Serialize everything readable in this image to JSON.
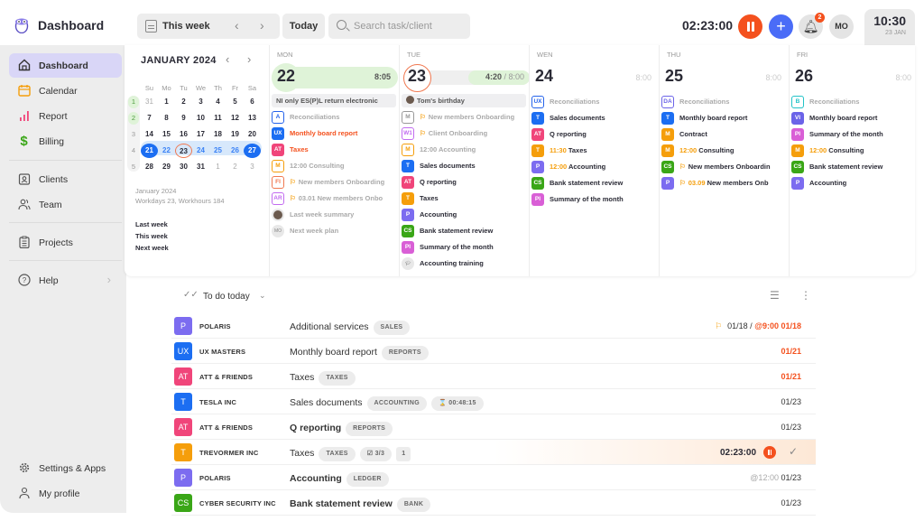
{
  "header": {
    "app_title": "Dashboard",
    "week_selector": "This week",
    "today_label": "Today",
    "search_placeholder": "Search task/client",
    "timer": "02:23:00",
    "notification_count": "2",
    "avatar_initials": "MO",
    "clock_time": "10:30",
    "clock_date": "23 JAN"
  },
  "sidebar": {
    "items": [
      {
        "label": "Dashboard",
        "icon": "home-icon",
        "active": true
      },
      {
        "label": "Calendar",
        "icon": "calendar-icon"
      },
      {
        "label": "Report",
        "icon": "bar-chart-icon"
      },
      {
        "label": "Billing",
        "icon": "dollar-icon"
      },
      {
        "label": "Clients",
        "icon": "contact-card-icon"
      },
      {
        "label": "Team",
        "icon": "team-icon"
      },
      {
        "label": "Projects",
        "icon": "clipboard-icon"
      },
      {
        "label": "Help",
        "icon": "help-icon"
      }
    ],
    "bottom": [
      {
        "label": "Settings & Apps",
        "icon": "gear-icon"
      },
      {
        "label": "My profile",
        "icon": "user-icon"
      }
    ]
  },
  "mini_calendar": {
    "month": "JANUARY 2024",
    "weekdays": [
      "Su",
      "Mo",
      "Tu",
      "We",
      "Th",
      "Fr",
      "Sa"
    ],
    "weeks": [
      {
        "num": "1",
        "days": [
          "31",
          "1",
          "2",
          "3",
          "4",
          "5",
          "6"
        ]
      },
      {
        "num": "2",
        "days": [
          "7",
          "8",
          "9",
          "10",
          "11",
          "12",
          "13"
        ]
      },
      {
        "num": "3",
        "days": [
          "14",
          "15",
          "16",
          "17",
          "18",
          "19",
          "20"
        ]
      },
      {
        "num": "4",
        "days": [
          "21",
          "22",
          "23",
          "24",
          "25",
          "26",
          "27"
        ]
      },
      {
        "num": "5",
        "days": [
          "28",
          "29",
          "30",
          "31",
          "1",
          "2",
          "3"
        ]
      }
    ],
    "info_month": "January 2024",
    "info_stats": "Workdays 23, Workhours 184",
    "quick_links": [
      "Last week",
      "This week",
      "Next week"
    ]
  },
  "days": [
    {
      "name": "MON",
      "num": "22",
      "hours": "8:05",
      "banner": "NI only ES(P)L return electronic",
      "events": [
        {
          "badge": "A",
          "color": "#2563eb",
          "outline": true,
          "text": "Reconciliations",
          "style": "g"
        },
        {
          "badge": "UX",
          "color": "#1c6ef2",
          "text": "Monthly board report",
          "style": "red"
        },
        {
          "badge": "AT",
          "color": "#f0457a",
          "text": "Taxes",
          "style": "red"
        },
        {
          "badge": "M",
          "color": "#f59e0b",
          "outline": true,
          "text": "12:00 Consulting",
          "style": "g"
        },
        {
          "badge": "FI",
          "color": "#f07850",
          "outline": true,
          "flag": true,
          "text": "New members Onboarding",
          "style": "g"
        },
        {
          "badge": "AR",
          "color": "#c26bf0",
          "outline": true,
          "flag": true,
          "text": "03.01 New members Onbo",
          "style": "g"
        },
        {
          "round": "photo",
          "text": "Last week summary",
          "style": "g"
        },
        {
          "round": "MO",
          "text": "Next week plan",
          "style": "g"
        }
      ]
    },
    {
      "name": "TUE",
      "num": "23",
      "hours_done": "4:20",
      "hours_total": "/ 8:00",
      "banner": "Tom's birthday",
      "events": [
        {
          "badge": "M",
          "color": "#999999",
          "outline": true,
          "flag": true,
          "text": "New members Onboarding",
          "style": "g"
        },
        {
          "badge": "W1",
          "color": "#c26bf0",
          "outline": true,
          "flag": true,
          "text": "Client Onboarding",
          "style": "g"
        },
        {
          "badge": "M",
          "color": "#f59e0b",
          "outline": true,
          "text": "12:00 Accounting",
          "style": "g"
        },
        {
          "badge": "T",
          "color": "#1c6ef2",
          "text": "Sales documents"
        },
        {
          "badge": "AT",
          "color": "#f0457a",
          "text": "Q reporting"
        },
        {
          "badge": "T",
          "color": "#f59e0b",
          "text": "Taxes"
        },
        {
          "badge": "P",
          "color": "#7c6cf0",
          "text": "Accounting"
        },
        {
          "badge": "CS",
          "color": "#3aa617",
          "text": "Bank statement review"
        },
        {
          "badge": "PI",
          "color": "#d95fd6",
          "text": "Summary of the month"
        },
        {
          "round": "cap",
          "text": "Accounting training"
        }
      ]
    },
    {
      "name": "WEN",
      "num": "24",
      "hours": "8:00",
      "events": [
        {
          "badge": "UX",
          "color": "#2563eb",
          "outline": true,
          "text": "Reconciliations",
          "style": "g"
        },
        {
          "badge": "T",
          "color": "#1c6ef2",
          "text": "Sales documents"
        },
        {
          "badge": "AT",
          "color": "#f0457a",
          "text": "Q reporting"
        },
        {
          "badge": "T",
          "color": "#f59e0b",
          "time": "11:30",
          "text": "Taxes"
        },
        {
          "badge": "P",
          "color": "#7c6cf0",
          "time": "12:00",
          "text": "Accounting"
        },
        {
          "badge": "CS",
          "color": "#3aa617",
          "text": "Bank statement review"
        },
        {
          "badge": "PI",
          "color": "#d95fd6",
          "text": "Summary of the month"
        }
      ]
    },
    {
      "name": "THU",
      "num": "25",
      "hours": "8:00",
      "events": [
        {
          "badge": "DA",
          "color": "#6b63e8",
          "outline": true,
          "text": "Reconciliations",
          "style": "g"
        },
        {
          "badge": "T",
          "color": "#1c6ef2",
          "text": "Monthly board report"
        },
        {
          "badge": "M",
          "color": "#f59e0b",
          "text": "Contract"
        },
        {
          "badge": "M",
          "color": "#f59e0b",
          "time": "12:00",
          "text": "Consulting"
        },
        {
          "badge": "CS",
          "color": "#3aa617",
          "flag": true,
          "text": "New members Onboardin"
        },
        {
          "badge": "P",
          "color": "#7c6cf0",
          "flag": true,
          "time": "03.09",
          "text": "New members Onb"
        }
      ]
    },
    {
      "name": "FRI",
      "num": "26",
      "hours": "8:00",
      "events": [
        {
          "badge": "B",
          "color": "#22c3c8",
          "outline": true,
          "text": "Reconciliations",
          "style": "g"
        },
        {
          "badge": "VI",
          "color": "#6b63e8",
          "text": "Monthly board report"
        },
        {
          "badge": "PI",
          "color": "#d95fd6",
          "text": "Summary of the month"
        },
        {
          "badge": "M",
          "color": "#f59e0b",
          "time": "12:00",
          "text": "Consulting"
        },
        {
          "badge": "CS",
          "color": "#3aa617",
          "text": "Bank statement review"
        },
        {
          "badge": "P",
          "color": "#7c6cf0",
          "text": "Accounting"
        }
      ]
    }
  ],
  "todo": {
    "title": "To do today",
    "rows": [
      {
        "badge": "P",
        "color": "#7c6cf0",
        "client": "POLARIS",
        "task": "Additional services",
        "tags": [
          "SALES"
        ],
        "due_flag": true,
        "due_prefix": "01/18 / ",
        "due_red": "@9:00 01/18"
      },
      {
        "badge": "UX",
        "color": "#1c6ef2",
        "client": "UX MASTERS",
        "task": "Monthly board report",
        "tags": [
          "REPORTS"
        ],
        "due": "01/21",
        "due_is_red": true
      },
      {
        "badge": "AT",
        "color": "#f0457a",
        "client": "ATT & FRIENDS",
        "task": "Taxes",
        "tags": [
          "TAXES"
        ],
        "due": "01/21",
        "due_is_red": true
      },
      {
        "badge": "T",
        "color": "#1c6ef2",
        "client": "TESLA INC",
        "task": "Sales documents",
        "tags": [
          "ACCOUNTING",
          "⌛ 00:48:15"
        ],
        "due": "01/23"
      },
      {
        "badge": "AT",
        "color": "#f0457a",
        "client": "ATT & FRIENDS",
        "task": "Q reporting",
        "bold": true,
        "tags": [
          "REPORTS"
        ],
        "due": "01/23"
      },
      {
        "badge": "T",
        "color": "#f59e0b",
        "client": "TREVORMER INC",
        "task": "Taxes",
        "tags": [
          "TAXES",
          "☑ 3/3"
        ],
        "comment_count": "1",
        "running": "02:23:00",
        "active": true
      },
      {
        "badge": "P",
        "color": "#7c6cf0",
        "client": "POLARIS",
        "task": "Accounting",
        "bold": true,
        "tags": [
          "LEDGER"
        ],
        "due_gray": "@12:00 ",
        "due": "01/23"
      },
      {
        "badge": "CS",
        "color": "#3aa617",
        "client": "CYBER SECURITY INC",
        "task": "Bank statement review",
        "bold": true,
        "tags": [
          "BANK"
        ],
        "due": "01/23"
      }
    ]
  }
}
